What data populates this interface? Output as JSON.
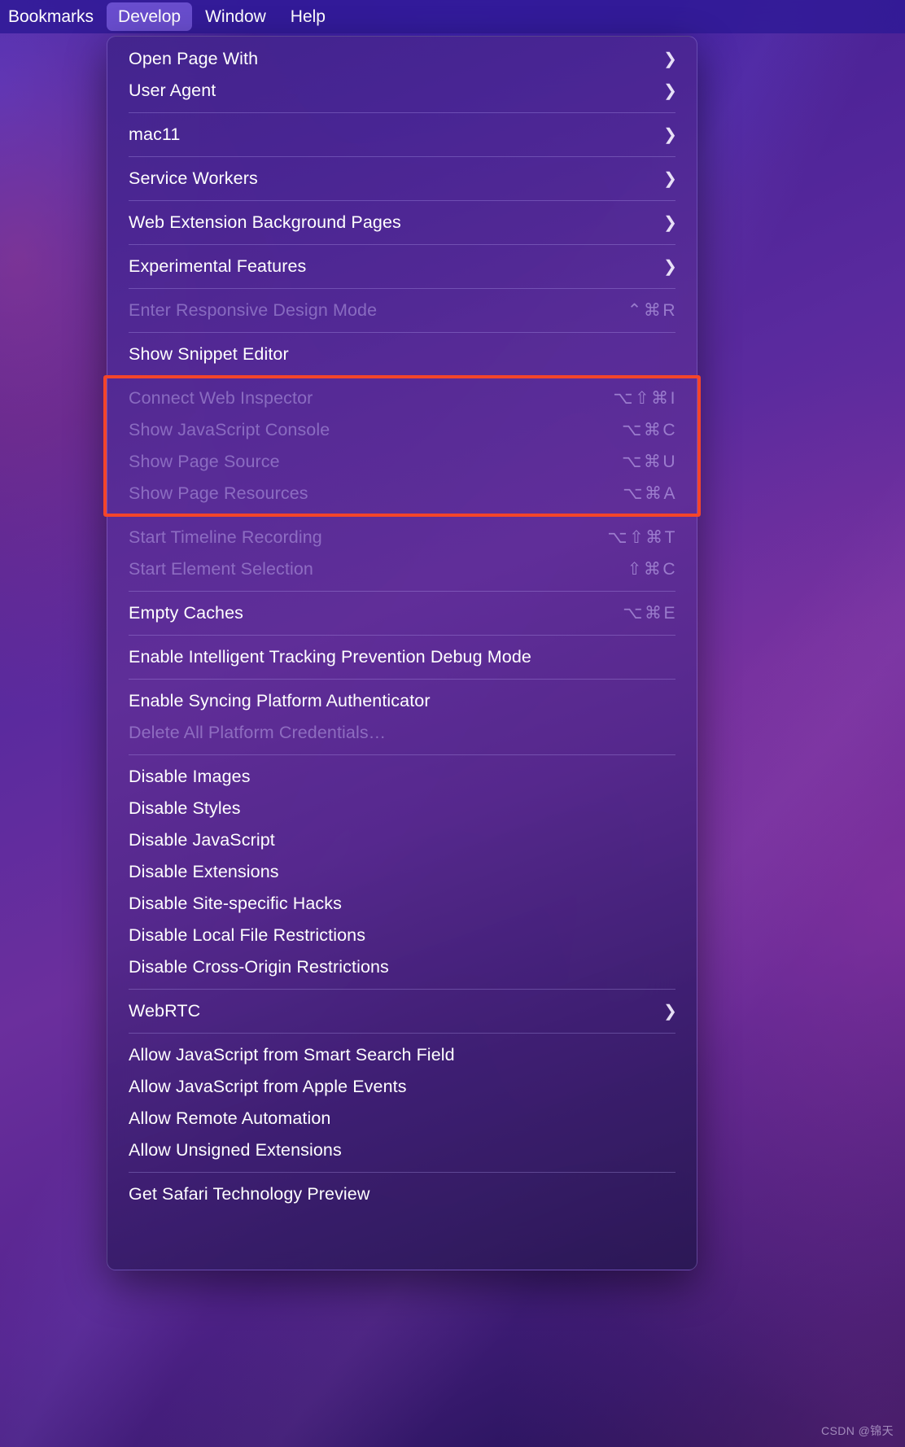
{
  "menubar": {
    "items": [
      {
        "label": "Bookmarks",
        "active": false
      },
      {
        "label": "Develop",
        "active": true
      },
      {
        "label": "Window",
        "active": false
      },
      {
        "label": "Help",
        "active": false
      }
    ]
  },
  "menu": {
    "title": "Develop",
    "groups": [
      {
        "items": [
          {
            "label": "Open Page With",
            "shortcut": "",
            "submenu": true,
            "disabled": false
          },
          {
            "label": "User Agent",
            "shortcut": "",
            "submenu": true,
            "disabled": false
          }
        ]
      },
      {
        "items": [
          {
            "label": "mac11",
            "shortcut": "",
            "submenu": true,
            "disabled": false
          }
        ]
      },
      {
        "items": [
          {
            "label": "Service Workers",
            "shortcut": "",
            "submenu": true,
            "disabled": false
          }
        ]
      },
      {
        "items": [
          {
            "label": "Web Extension Background Pages",
            "shortcut": "",
            "submenu": true,
            "disabled": false
          }
        ]
      },
      {
        "items": [
          {
            "label": "Experimental Features",
            "shortcut": "",
            "submenu": true,
            "disabled": false
          }
        ]
      },
      {
        "items": [
          {
            "label": "Enter Responsive Design Mode",
            "shortcut": "⌃⌘R",
            "submenu": false,
            "disabled": true
          }
        ]
      },
      {
        "items": [
          {
            "label": "Show Snippet Editor",
            "shortcut": "",
            "submenu": false,
            "disabled": false
          }
        ]
      },
      {
        "highlighted": true,
        "items": [
          {
            "label": "Connect Web Inspector",
            "shortcut": "⌥⇧⌘I",
            "submenu": false,
            "disabled": true
          },
          {
            "label": "Show JavaScript Console",
            "shortcut": "⌥⌘C",
            "submenu": false,
            "disabled": true
          },
          {
            "label": "Show Page Source",
            "shortcut": "⌥⌘U",
            "submenu": false,
            "disabled": true
          },
          {
            "label": "Show Page Resources",
            "shortcut": "⌥⌘A",
            "submenu": false,
            "disabled": true
          }
        ]
      },
      {
        "items": [
          {
            "label": "Start Timeline Recording",
            "shortcut": "⌥⇧⌘T",
            "submenu": false,
            "disabled": true
          },
          {
            "label": "Start Element Selection",
            "shortcut": "⇧⌘C",
            "submenu": false,
            "disabled": true
          }
        ]
      },
      {
        "items": [
          {
            "label": "Empty Caches",
            "shortcut": "⌥⌘E",
            "submenu": false,
            "disabled": false
          }
        ]
      },
      {
        "items": [
          {
            "label": "Enable Intelligent Tracking Prevention Debug Mode",
            "shortcut": "",
            "submenu": false,
            "disabled": false
          }
        ]
      },
      {
        "items": [
          {
            "label": "Enable Syncing Platform Authenticator",
            "shortcut": "",
            "submenu": false,
            "disabled": false
          },
          {
            "label": "Delete All Platform Credentials…",
            "shortcut": "",
            "submenu": false,
            "disabled": true
          }
        ]
      },
      {
        "items": [
          {
            "label": "Disable Images",
            "shortcut": "",
            "submenu": false,
            "disabled": false
          },
          {
            "label": "Disable Styles",
            "shortcut": "",
            "submenu": false,
            "disabled": false
          },
          {
            "label": "Disable JavaScript",
            "shortcut": "",
            "submenu": false,
            "disabled": false
          },
          {
            "label": "Disable Extensions",
            "shortcut": "",
            "submenu": false,
            "disabled": false
          },
          {
            "label": "Disable Site-specific Hacks",
            "shortcut": "",
            "submenu": false,
            "disabled": false
          },
          {
            "label": "Disable Local File Restrictions",
            "shortcut": "",
            "submenu": false,
            "disabled": false
          },
          {
            "label": "Disable Cross-Origin Restrictions",
            "shortcut": "",
            "submenu": false,
            "disabled": false
          }
        ]
      },
      {
        "items": [
          {
            "label": "WebRTC",
            "shortcut": "",
            "submenu": true,
            "disabled": false
          }
        ]
      },
      {
        "items": [
          {
            "label": "Allow JavaScript from Smart Search Field",
            "shortcut": "",
            "submenu": false,
            "disabled": false
          },
          {
            "label": "Allow JavaScript from Apple Events",
            "shortcut": "",
            "submenu": false,
            "disabled": false
          },
          {
            "label": "Allow Remote Automation",
            "shortcut": "",
            "submenu": false,
            "disabled": false
          },
          {
            "label": "Allow Unsigned Extensions",
            "shortcut": "",
            "submenu": false,
            "disabled": false
          }
        ]
      },
      {
        "items": [
          {
            "label": "Get Safari Technology Preview",
            "shortcut": "",
            "submenu": false,
            "disabled": false
          }
        ]
      }
    ]
  },
  "annotation": {
    "color": "#f4452a",
    "label": "highlight-rectangle"
  },
  "watermark": {
    "text": "CSDN @锦天"
  },
  "icons": {
    "submenu_chevron": "chevron-right-icon"
  }
}
